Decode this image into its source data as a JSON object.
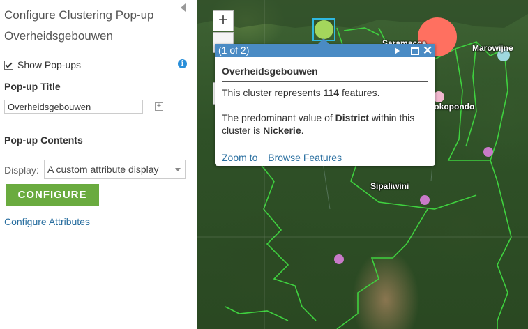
{
  "panel": {
    "title": "Configure Clustering Pop-up Overheidsgebouwen",
    "show_popups_label": "Show Pop-ups",
    "info_icon_glyph": "i",
    "popup_title_label": "Pop-up Title",
    "popup_title_value": "Overheidsgebouwen",
    "plus_glyph": "+",
    "popup_contents_label": "Pop-up Contents",
    "display_label": "Display:",
    "display_value": "A custom attribute display",
    "configure_button": "CONFIGURE",
    "configure_attributes_link": "Configure Attributes"
  },
  "map": {
    "zoom_in": "+",
    "labels": {
      "saramacca": "Saramacca",
      "marowijne": "Marowijne",
      "brokopondo": "Brokopondo",
      "sipaliwini": "Sipaliwini"
    },
    "colors": {
      "boundary": "#3fd13f",
      "cluster_green": "#a4d65c",
      "cluster_red": "#ff7060",
      "cluster_cyan": "#9fd8df",
      "cluster_pink": "#f1b8cf",
      "cluster_purple": "#c97ac9",
      "selection": "#2fb8e0"
    }
  },
  "popup": {
    "counter": "(1 of 2)",
    "close_glyph": "✕",
    "title": "Overheidsgebouwen",
    "line1_pre": "This cluster represents ",
    "line1_count": "114",
    "line1_post": " features.",
    "line2_pre": "The predominant value of ",
    "line2_field": "District",
    "line2_mid": " within this cluster is ",
    "line2_value": "Nickerie",
    "line2_post": ".",
    "zoom_to": "Zoom to",
    "browse_features": "Browse Features"
  }
}
